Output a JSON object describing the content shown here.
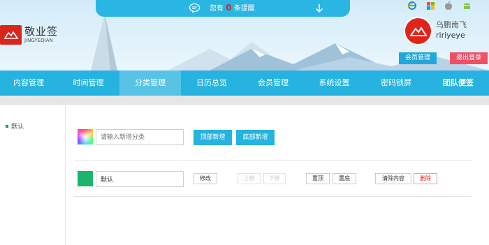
{
  "app": {
    "brand_name": "敬业签",
    "brand_sub": "JINGYEQIAN"
  },
  "reminder": {
    "prefix": "您有",
    "count": "0",
    "suffix": "条提醒"
  },
  "platforms": [
    "ie-icon",
    "windows-icon",
    "apple-icon",
    "android-icon"
  ],
  "user": {
    "name": "乌鹏南飞",
    "id": "ririyeye",
    "member_button": "会员管理",
    "logout_button": "退出登录"
  },
  "nav": {
    "items": [
      "内容管理",
      "时间管理",
      "分类管理",
      "日历总览",
      "会员管理",
      "系统设置",
      "密码锁屏",
      "团队便签"
    ],
    "active": "分类管理"
  },
  "sidebar": {
    "items": [
      "默认"
    ]
  },
  "add_category": {
    "placeholder": "请输入新增分类",
    "top_add": "顶部新增",
    "bottom_add": "底部新增"
  },
  "categories": [
    {
      "name": "默认",
      "color": "#1db56b",
      "actions": {
        "edit": "修改",
        "move_up": "上移",
        "move_down": "下移",
        "pin_top": "置顶",
        "pin_bottom": "置底",
        "clear": "清除内容",
        "delete": "删除"
      }
    }
  ],
  "colors": {
    "primary": "#27b3df",
    "logout": "#ef5164",
    "brand_red": "#d9261c"
  }
}
